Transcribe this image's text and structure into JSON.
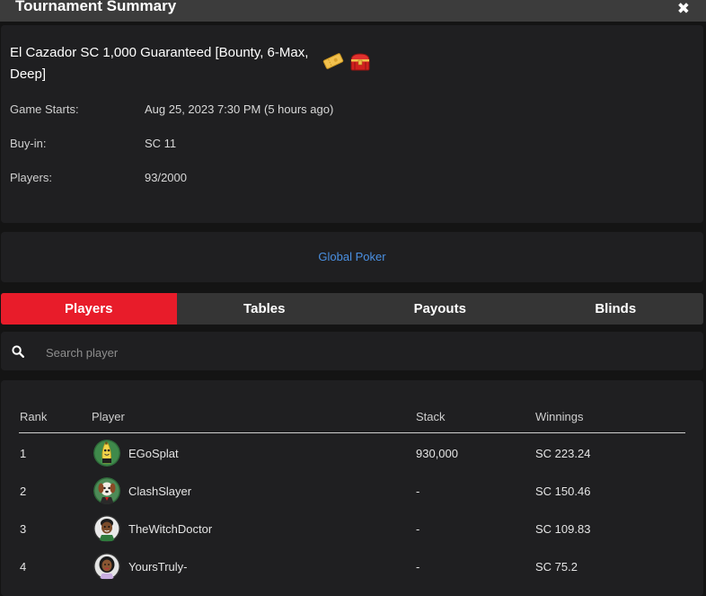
{
  "header": {
    "title": "Tournament Summary",
    "close_glyph": "✖"
  },
  "tournament": {
    "name": "El Cazador SC 1,000 Guaranteed [Bounty, 6-Max, Deep]",
    "badges": [
      "ticket-icon",
      "treasure-chest-icon"
    ],
    "details": [
      {
        "label": "Game Starts:",
        "value": "Aug 25, 2023 7:30 PM (5 hours ago)"
      },
      {
        "label": "Buy-in:",
        "value": "SC 11"
      },
      {
        "label": "Players:",
        "value": "93/2000"
      }
    ]
  },
  "site": {
    "link_text": "Global Poker"
  },
  "tabs": [
    {
      "label": "Players",
      "active": true
    },
    {
      "label": "Tables",
      "active": false
    },
    {
      "label": "Payouts",
      "active": false
    },
    {
      "label": "Blinds",
      "active": false
    }
  ],
  "search": {
    "placeholder": "Search player",
    "value": ""
  },
  "table": {
    "columns": [
      "Rank",
      "Player",
      "Stack",
      "Winnings"
    ],
    "rows": [
      {
        "rank": "1",
        "player": "EGoSplat",
        "avatar": "banana-avatar",
        "stack": "930,000",
        "winnings": "SC 223.24"
      },
      {
        "rank": "2",
        "player": "ClashSlayer",
        "avatar": "dog-avatar",
        "stack": "-",
        "winnings": "SC 150.46"
      },
      {
        "rank": "3",
        "player": "TheWitchDoctor",
        "avatar": "man-avatar",
        "stack": "-",
        "winnings": "SC 109.83"
      },
      {
        "rank": "4",
        "player": "YoursTruly-",
        "avatar": "woman-avatar",
        "stack": "-",
        "winnings": "SC 75.2"
      }
    ]
  },
  "colors": {
    "accent": "#e81c2a",
    "link": "#4a90e2",
    "card": "#1f1f21",
    "background": "#141414",
    "header": "#3c3c3c"
  }
}
